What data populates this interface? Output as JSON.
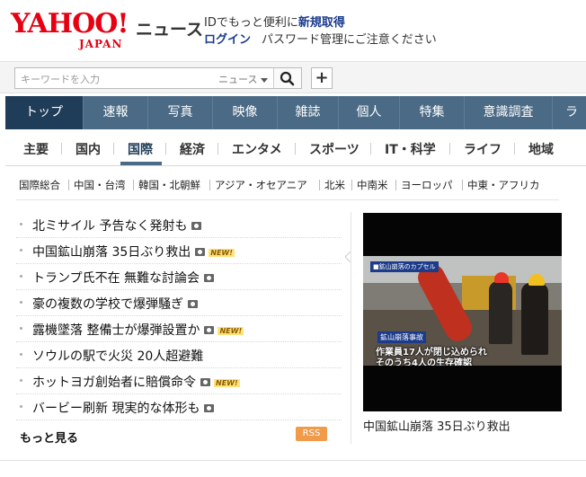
{
  "header": {
    "logo_text": "YAHOO!",
    "logo_sub": "JAPAN",
    "service": "ニュース",
    "id_prompt": "IDでもっと便利に",
    "id_register": "新規取得",
    "login": "ログイン",
    "password_notice": "パスワード管理にご注意ください"
  },
  "search": {
    "placeholder": "キーワードを入力",
    "category": "ニュース",
    "add_label": "+"
  },
  "global_nav": {
    "tabs": [
      {
        "label": "トップ"
      },
      {
        "label": "速報"
      },
      {
        "label": "写真"
      },
      {
        "label": "映像"
      },
      {
        "label": "雑誌"
      },
      {
        "label": "個人"
      },
      {
        "label": "特集"
      },
      {
        "label": "意識調査"
      },
      {
        "label": "ラ"
      }
    ]
  },
  "local_nav": {
    "items": [
      {
        "label": "主要"
      },
      {
        "label": "国内"
      },
      {
        "label": "国際"
      },
      {
        "label": "経済"
      },
      {
        "label": "エンタメ"
      },
      {
        "label": "スポーツ"
      },
      {
        "label": "IT・科学"
      },
      {
        "label": "ライフ"
      },
      {
        "label": "地域"
      }
    ]
  },
  "sub_nav": {
    "items": [
      {
        "label": "国際総合"
      },
      {
        "label": "中国・台湾"
      },
      {
        "label": "韓国・北朝鮮"
      },
      {
        "label": "アジア・オセアニア"
      },
      {
        "label": "北米"
      },
      {
        "label": "中南米"
      },
      {
        "label": "ヨーロッパ"
      },
      {
        "label": "中東・アフリカ"
      }
    ]
  },
  "news": {
    "new_badge": "NEW!",
    "items": [
      {
        "title": "北ミサイル 予告なく発射も"
      },
      {
        "title": "中国鉱山崩落 35日ぶり救出"
      },
      {
        "title": "トランプ氏不在 無難な討論会"
      },
      {
        "title": "豪の複数の学校で爆弾騒ぎ"
      },
      {
        "title": "露機墜落 整備士が爆弾設置か"
      },
      {
        "title": "ソウルの駅で火災 20人超避難"
      },
      {
        "title": "ホットヨガ創始者に賠償命令"
      },
      {
        "title": "バービー刷新 現実的な体形も"
      }
    ],
    "more_label": "もっと見る",
    "rss_label": "RSS"
  },
  "photo": {
    "badge_small": "■鉱山崩落のカプセル",
    "badge_label": "鉱山崩落事故",
    "caption_line1": "作業員17人が閉じ込められ",
    "caption_line2": "そのうち4人の生存確認",
    "caption": "中国鉱山崩落 35日ぶり救出"
  }
}
